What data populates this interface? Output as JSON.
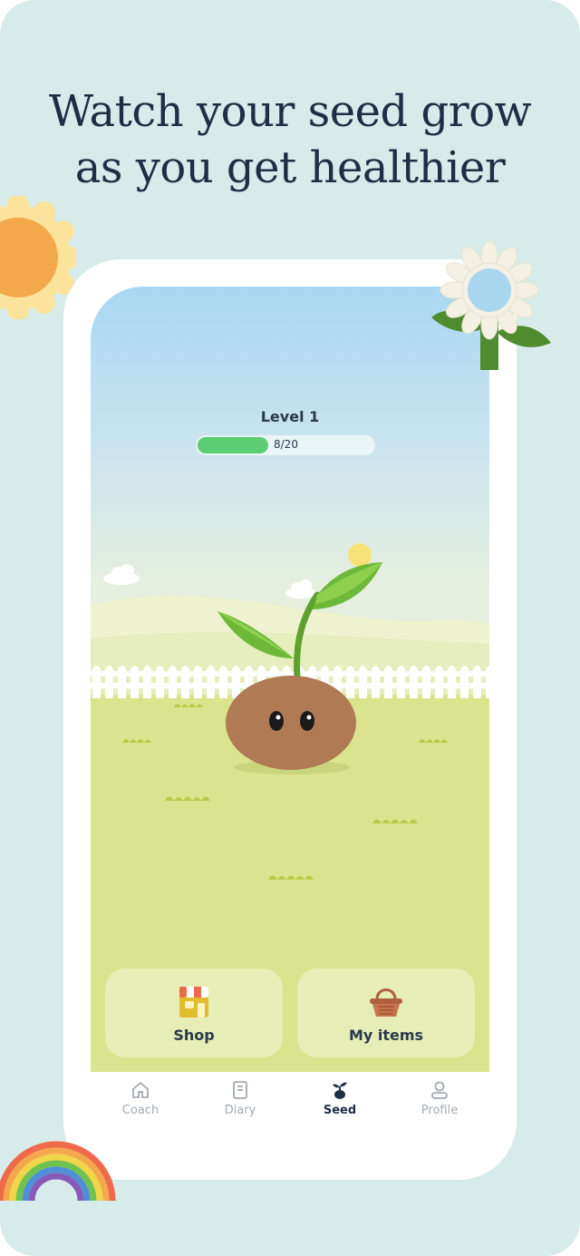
{
  "headline": {
    "line1": "Watch your seed grow",
    "line2": "as you get healthier"
  },
  "level": {
    "label": "Level 1",
    "progress_text": "8/20",
    "current": 8,
    "total": 20
  },
  "actions": {
    "shop_label": "Shop",
    "items_label": "My items"
  },
  "tabs": [
    {
      "label": "Coach",
      "icon": "home-icon"
    },
    {
      "label": "Diary",
      "icon": "diary-icon"
    },
    {
      "label": "Seed",
      "icon": "sprout-icon",
      "active": true
    },
    {
      "label": "Profile",
      "icon": "person-icon"
    }
  ],
  "colors": {
    "background": "#d7ecea",
    "headline": "#1e2f45",
    "progress": "#5ccd72",
    "grass": "#dae48e",
    "seed": "#b07a55"
  }
}
